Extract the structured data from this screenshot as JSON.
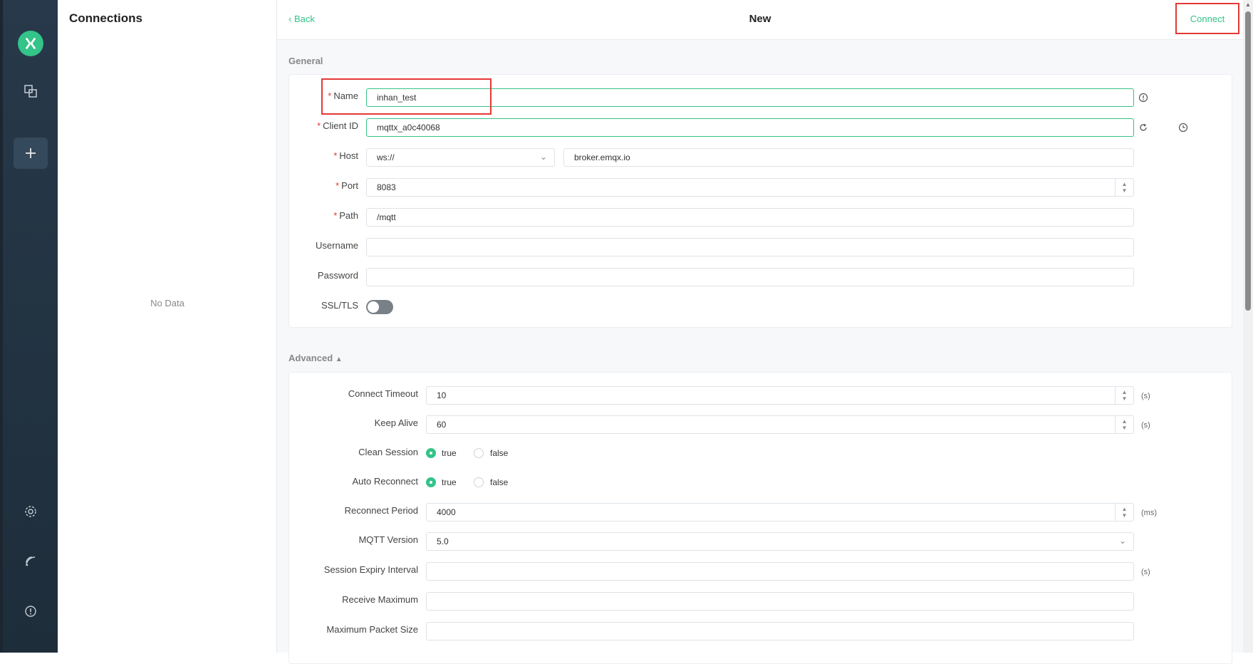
{
  "sidebar": {
    "icons": [
      "logo-icon",
      "connections-icon",
      "add-icon",
      "settings-icon",
      "log-icon",
      "about-icon"
    ]
  },
  "connections": {
    "title": "Connections",
    "empty_text": "No Data"
  },
  "header": {
    "back_label": "Back",
    "title": "New",
    "connect_label": "Connect"
  },
  "general": {
    "section_label": "General",
    "name": {
      "label": "Name",
      "value": "inhan_test"
    },
    "client_id": {
      "label": "Client ID",
      "value": "mqttx_a0c40068"
    },
    "host": {
      "label": "Host",
      "protocol": "ws://",
      "value": "broker.emqx.io"
    },
    "port": {
      "label": "Port",
      "value": "8083"
    },
    "path": {
      "label": "Path",
      "value": "/mqtt"
    },
    "username": {
      "label": "Username",
      "value": ""
    },
    "password": {
      "label": "Password",
      "value": ""
    },
    "ssl": {
      "label": "SSL/TLS",
      "enabled": false
    }
  },
  "advanced": {
    "section_label": "Advanced",
    "connect_timeout": {
      "label": "Connect Timeout",
      "value": "10",
      "unit": "(s)"
    },
    "keep_alive": {
      "label": "Keep Alive",
      "value": "60",
      "unit": "(s)"
    },
    "clean_session": {
      "label": "Clean Session",
      "true_label": "true",
      "false_label": "false",
      "selected": "true"
    },
    "auto_reconnect": {
      "label": "Auto Reconnect",
      "true_label": "true",
      "false_label": "false",
      "selected": "true"
    },
    "reconnect_period": {
      "label": "Reconnect Period",
      "value": "4000",
      "unit": "(ms)"
    },
    "mqtt_version": {
      "label": "MQTT Version",
      "value": "5.0"
    },
    "session_expiry": {
      "label": "Session Expiry Interval",
      "value": "",
      "unit": "(s)"
    },
    "receive_maximum": {
      "label": "Receive Maximum",
      "value": ""
    },
    "max_packet_size": {
      "label": "Maximum Packet Size",
      "value": ""
    }
  },
  "colors": {
    "accent": "#34c388",
    "highlight": "#e53935",
    "sidebar_bg": "#27394a"
  }
}
